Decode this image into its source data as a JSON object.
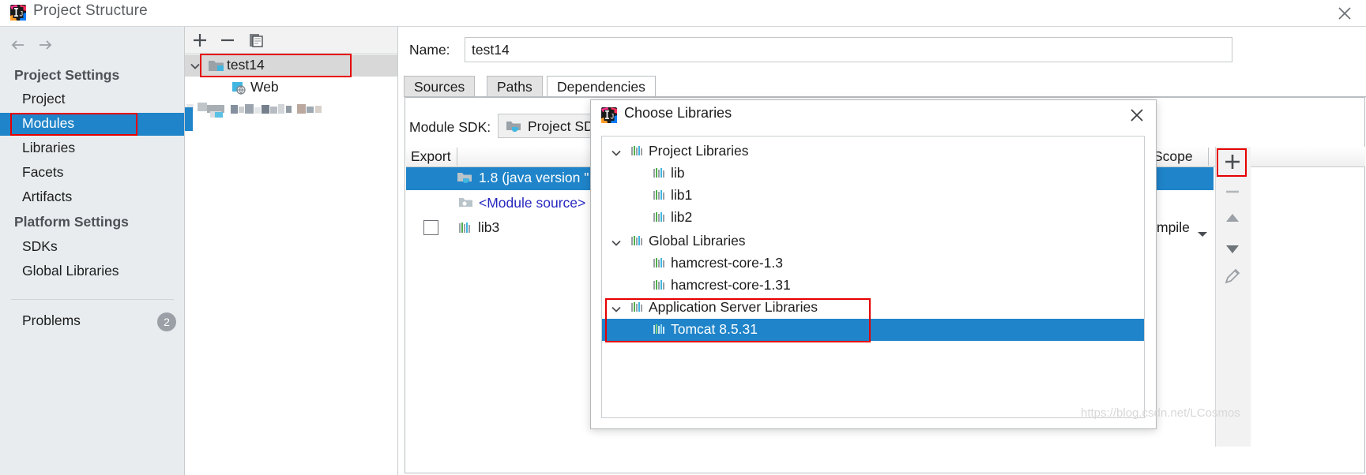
{
  "window": {
    "title": "Project Structure",
    "app_icon": "intellij-idea-icon",
    "close_icon": "close-icon"
  },
  "navigation": {
    "back_icon": "arrow-left-icon",
    "forward_icon": "arrow-right-icon"
  },
  "sidebar": {
    "groups": [
      {
        "label": "Project Settings"
      },
      {
        "label": "Platform Settings"
      }
    ],
    "items": [
      {
        "label": "Project",
        "selected": false
      },
      {
        "label": "Modules",
        "selected": true
      },
      {
        "label": "Libraries",
        "selected": false
      },
      {
        "label": "Facets",
        "selected": false
      },
      {
        "label": "Artifacts",
        "selected": false
      },
      {
        "label": "SDKs",
        "selected": false
      },
      {
        "label": "Global Libraries",
        "selected": false
      }
    ],
    "problems": {
      "label": "Problems",
      "count": "2"
    }
  },
  "tree_panel": {
    "toolbar": {
      "add_icon": "plus-icon",
      "remove_icon": "minus-icon",
      "copy_icon": "copy-icon"
    },
    "nodes": [
      {
        "label": "test14",
        "icon": "module-folder-icon",
        "expanded": true,
        "selected": true
      },
      {
        "label": "Web",
        "icon": "web-facet-icon",
        "expanded": false,
        "selected": false
      }
    ]
  },
  "module": {
    "name_label": "Name:",
    "name_value": "test14",
    "tabs": [
      {
        "label": "Sources",
        "active": false
      },
      {
        "label": "Paths",
        "active": false
      },
      {
        "label": "Dependencies",
        "active": true
      }
    ],
    "sdk_label": "Module SDK:",
    "sdk_value": "Project SDK",
    "sdk_icon": "jdk-folder-icon",
    "sdk_caret_icon": "chevron-down-icon",
    "table": {
      "columns": [
        "Export",
        "Scope"
      ],
      "rows": [
        {
          "export_checked": null,
          "icon": "jdk-folder-icon",
          "name": "1.8 (java version \"",
          "scope": "",
          "selected": true
        },
        {
          "export_checked": null,
          "icon": "module-source-icon",
          "name": "<Module source>",
          "scope": "",
          "selected": false
        },
        {
          "export_checked": false,
          "icon": "library-icon",
          "name": "lib3",
          "scope": "mpile",
          "selected": false
        }
      ]
    },
    "rail_buttons": [
      {
        "name": "add",
        "icon": "plus-icon",
        "highlighted": true
      },
      {
        "name": "remove",
        "icon": "minus-icon",
        "highlighted": false
      },
      {
        "name": "up",
        "icon": "triangle-up-icon",
        "highlighted": false
      },
      {
        "name": "down",
        "icon": "triangle-down-icon",
        "highlighted": false
      },
      {
        "name": "edit",
        "icon": "pencil-icon",
        "highlighted": false
      }
    ]
  },
  "dialog": {
    "title": "Choose Libraries",
    "icon": "intellij-idea-icon",
    "close_icon": "close-icon",
    "tree": [
      {
        "label": "Project Libraries",
        "level": 0,
        "expanded": true,
        "icon": "library-icon",
        "selected": false,
        "outlined": false
      },
      {
        "label": "lib",
        "level": 1,
        "expanded": null,
        "icon": "library-icon",
        "selected": false,
        "outlined": false
      },
      {
        "label": "lib1",
        "level": 1,
        "expanded": null,
        "icon": "library-icon",
        "selected": false,
        "outlined": false
      },
      {
        "label": "lib2",
        "level": 1,
        "expanded": null,
        "icon": "library-icon",
        "selected": false,
        "outlined": false
      },
      {
        "label": "Global Libraries",
        "level": 0,
        "expanded": true,
        "icon": "library-icon",
        "selected": false,
        "outlined": false
      },
      {
        "label": "hamcrest-core-1.3",
        "level": 1,
        "expanded": null,
        "icon": "library-icon",
        "selected": false,
        "outlined": false
      },
      {
        "label": "hamcrest-core-1.31",
        "level": 1,
        "expanded": null,
        "icon": "library-icon",
        "selected": false,
        "outlined": false
      },
      {
        "label": "Application Server Libraries",
        "level": 0,
        "expanded": true,
        "icon": "library-icon",
        "selected": false,
        "outlined": true
      },
      {
        "label": "Tomcat 8.5.31",
        "level": 1,
        "expanded": null,
        "icon": "library-icon",
        "selected": true,
        "outlined": true
      }
    ]
  },
  "watermark": "https://blog.csdn.net/LCosmos",
  "colors": {
    "selection_blue": "#1f84c9",
    "highlight_red": "#e60000",
    "sidebar_bg": "#e8ecef",
    "link_blue": "#2727c0"
  }
}
